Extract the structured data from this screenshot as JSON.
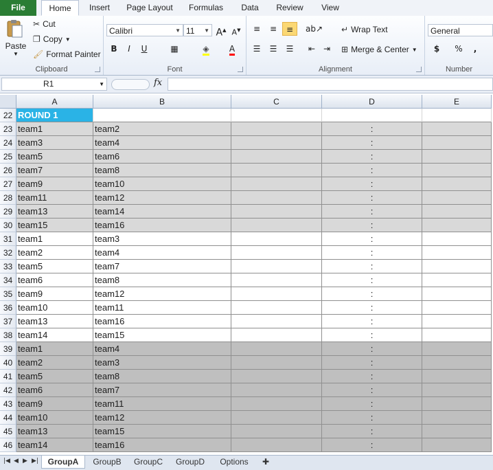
{
  "ribbon_tabs": [
    "File",
    "Home",
    "Insert",
    "Page Layout",
    "Formulas",
    "Data",
    "Review",
    "View"
  ],
  "clipboard": {
    "paste": "Paste",
    "cut": "Cut",
    "copy": "Copy",
    "format_painter": "Format Painter",
    "label": "Clipboard"
  },
  "font": {
    "name": "Calibri",
    "size": "11",
    "label": "Font"
  },
  "alignment": {
    "wrap": "Wrap Text",
    "merge": "Merge & Center",
    "label": "Alignment"
  },
  "number": {
    "format": "General",
    "label": "Number"
  },
  "formula_bar": {
    "name_box": "R1",
    "fx": "fx",
    "formula": ""
  },
  "columns": [
    "A",
    "B",
    "C",
    "D",
    "E"
  ],
  "colors": {
    "header_cell": "#2ab3e6",
    "light_band": "#d9d9d9",
    "dark_band": "#bfbfbf",
    "white": "#ffffff"
  },
  "rows": [
    {
      "num": "22",
      "a": "ROUND 1",
      "b": "",
      "d": "",
      "band": "header"
    },
    {
      "num": "23",
      "a": "team1",
      "b": "team2",
      "d": ":",
      "band": "light"
    },
    {
      "num": "24",
      "a": "team3",
      "b": "team4",
      "d": ":",
      "band": "light"
    },
    {
      "num": "25",
      "a": "team5",
      "b": "team6",
      "d": ":",
      "band": "light"
    },
    {
      "num": "26",
      "a": "team7",
      "b": "team8",
      "d": ":",
      "band": "light"
    },
    {
      "num": "27",
      "a": "team9",
      "b": "team10",
      "d": ":",
      "band": "light"
    },
    {
      "num": "28",
      "a": "team11",
      "b": "team12",
      "d": ":",
      "band": "light"
    },
    {
      "num": "29",
      "a": "team13",
      "b": "team14",
      "d": ":",
      "band": "light"
    },
    {
      "num": "30",
      "a": "team15",
      "b": "team16",
      "d": ":",
      "band": "light"
    },
    {
      "num": "31",
      "a": "team1",
      "b": "team3",
      "d": ":",
      "band": "white"
    },
    {
      "num": "32",
      "a": "team2",
      "b": "team4",
      "d": ":",
      "band": "white"
    },
    {
      "num": "33",
      "a": "team5",
      "b": "team7",
      "d": ":",
      "band": "white"
    },
    {
      "num": "34",
      "a": "team6",
      "b": "team8",
      "d": ":",
      "band": "white"
    },
    {
      "num": "35",
      "a": "team9",
      "b": "team12",
      "d": ":",
      "band": "white"
    },
    {
      "num": "36",
      "a": "team10",
      "b": "team11",
      "d": ":",
      "band": "white"
    },
    {
      "num": "37",
      "a": "team13",
      "b": "team16",
      "d": ":",
      "band": "white"
    },
    {
      "num": "38",
      "a": "team14",
      "b": "team15",
      "d": ":",
      "band": "white"
    },
    {
      "num": "39",
      "a": "team1",
      "b": "team4",
      "d": ":",
      "band": "dark"
    },
    {
      "num": "40",
      "a": "team2",
      "b": "team3",
      "d": ":",
      "band": "dark"
    },
    {
      "num": "41",
      "a": "team5",
      "b": "team8",
      "d": ":",
      "band": "dark"
    },
    {
      "num": "42",
      "a": "team6",
      "b": "team7",
      "d": ":",
      "band": "dark"
    },
    {
      "num": "43",
      "a": "team9",
      "b": "team11",
      "d": ":",
      "band": "dark"
    },
    {
      "num": "44",
      "a": "team10",
      "b": "team12",
      "d": ":",
      "band": "dark"
    },
    {
      "num": "45",
      "a": "team13",
      "b": "team15",
      "d": ":",
      "band": "dark"
    },
    {
      "num": "46",
      "a": "team14",
      "b": "team16",
      "d": ":",
      "band": "dark"
    }
  ],
  "sheet_tabs": [
    "GroupA",
    "GroupB",
    "GroupC",
    "GroupD",
    "Options"
  ],
  "active_sheet": "GroupA"
}
